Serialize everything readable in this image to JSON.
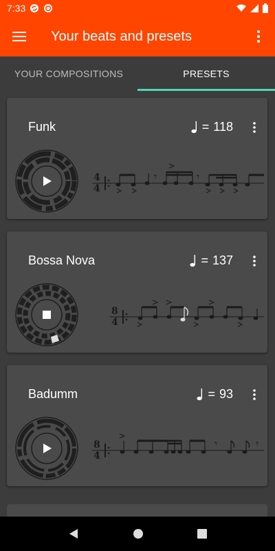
{
  "status": {
    "time": "7:33"
  },
  "app_bar": {
    "title": "Your beats and presets"
  },
  "tabs": [
    {
      "label": "YOUR COMPOSITIONS",
      "active": false
    },
    {
      "label": "PRESETS",
      "active": true
    }
  ],
  "colors": {
    "accent": "#ff4500",
    "tab_indicator": "#4fd6b5",
    "card": "#4a4a4a",
    "background": "#3c3c3c"
  },
  "presets": [
    {
      "name": "Funk",
      "tempo_prefix": "= ",
      "tempo": "118",
      "state": "play",
      "time_signature": [
        "4",
        "4"
      ]
    },
    {
      "name": "Bossa Nova",
      "tempo_prefix": "= ",
      "tempo": "137",
      "state": "stop",
      "time_signature": [
        "8",
        "4"
      ]
    },
    {
      "name": "Badumm",
      "tempo_prefix": "= ",
      "tempo": "93",
      "state": "play",
      "time_signature": [
        "8",
        "4"
      ]
    }
  ],
  "icons": {
    "menu": "hamburger-icon",
    "more": "more-vert-icon",
    "play": "play-icon",
    "stop": "stop-icon",
    "quarter_note": "quarter-note-icon",
    "nav_back": "back-icon",
    "nav_home": "home-icon",
    "nav_recents": "recents-icon"
  }
}
